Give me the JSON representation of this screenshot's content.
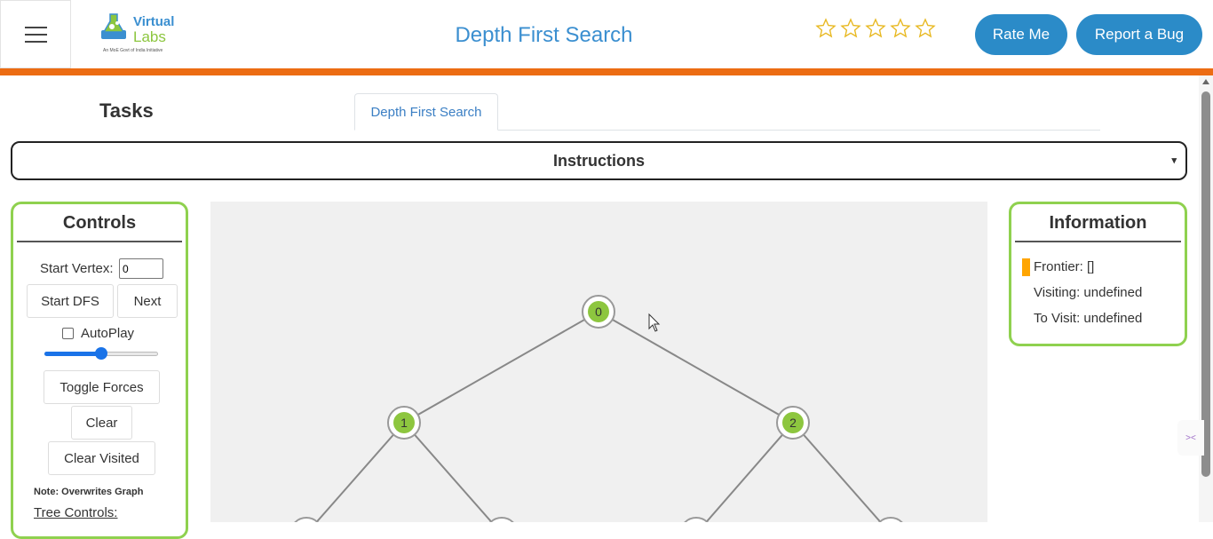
{
  "header": {
    "logo_virtual": "Virtual",
    "logo_labs": "Labs",
    "logo_tagline": "An MoE Govt of India Initiative",
    "title": "Depth First Search",
    "rating_stars": 5,
    "rate_label": "Rate Me",
    "bug_label": "Report a Bug"
  },
  "tasks": {
    "title": "Tasks",
    "tabs": [
      {
        "label": "Depth First Search"
      }
    ]
  },
  "instructions": {
    "label": "Instructions",
    "caret": "▾"
  },
  "controls": {
    "title": "Controls",
    "start_vertex_label": "Start Vertex:",
    "start_vertex_value": "0",
    "start_dfs_label": "Start DFS",
    "next_label": "Next",
    "autoplay_label": "AutoPlay",
    "autoplay_checked": false,
    "speed_fraction": 0.5,
    "toggle_forces_label": "Toggle Forces",
    "clear_label": "Clear",
    "clear_visited_label": "Clear Visited",
    "note": "Note: Overwrites Graph",
    "tree_controls_label": "Tree Controls:"
  },
  "graph": {
    "nodes": [
      {
        "id": "0",
        "label": "0",
        "visited": true
      },
      {
        "id": "1",
        "label": "1",
        "visited": true
      },
      {
        "id": "2",
        "label": "2",
        "visited": true
      },
      {
        "id": "3",
        "label": "",
        "visited": false
      },
      {
        "id": "4",
        "label": "",
        "visited": false
      },
      {
        "id": "5",
        "label": "",
        "visited": false
      },
      {
        "id": "6",
        "label": "",
        "visited": false
      }
    ],
    "edges": [
      [
        "0",
        "1"
      ],
      [
        "0",
        "2"
      ],
      [
        "1",
        "3"
      ],
      [
        "1",
        "4"
      ],
      [
        "2",
        "5"
      ],
      [
        "2",
        "6"
      ]
    ],
    "visited_color": "#8dc63f",
    "edge_color": "#888888"
  },
  "information": {
    "title": "Information",
    "frontier": "Frontier: []",
    "visiting": "Visiting: undefined",
    "to_visit": "To Visit: undefined",
    "marker_color": "#ffa500"
  },
  "colors": {
    "accent": "#2b8bc8",
    "title_blue": "#3b8fd0",
    "orange_bar": "#ec6c13",
    "panel_border": "#8fd14f"
  }
}
